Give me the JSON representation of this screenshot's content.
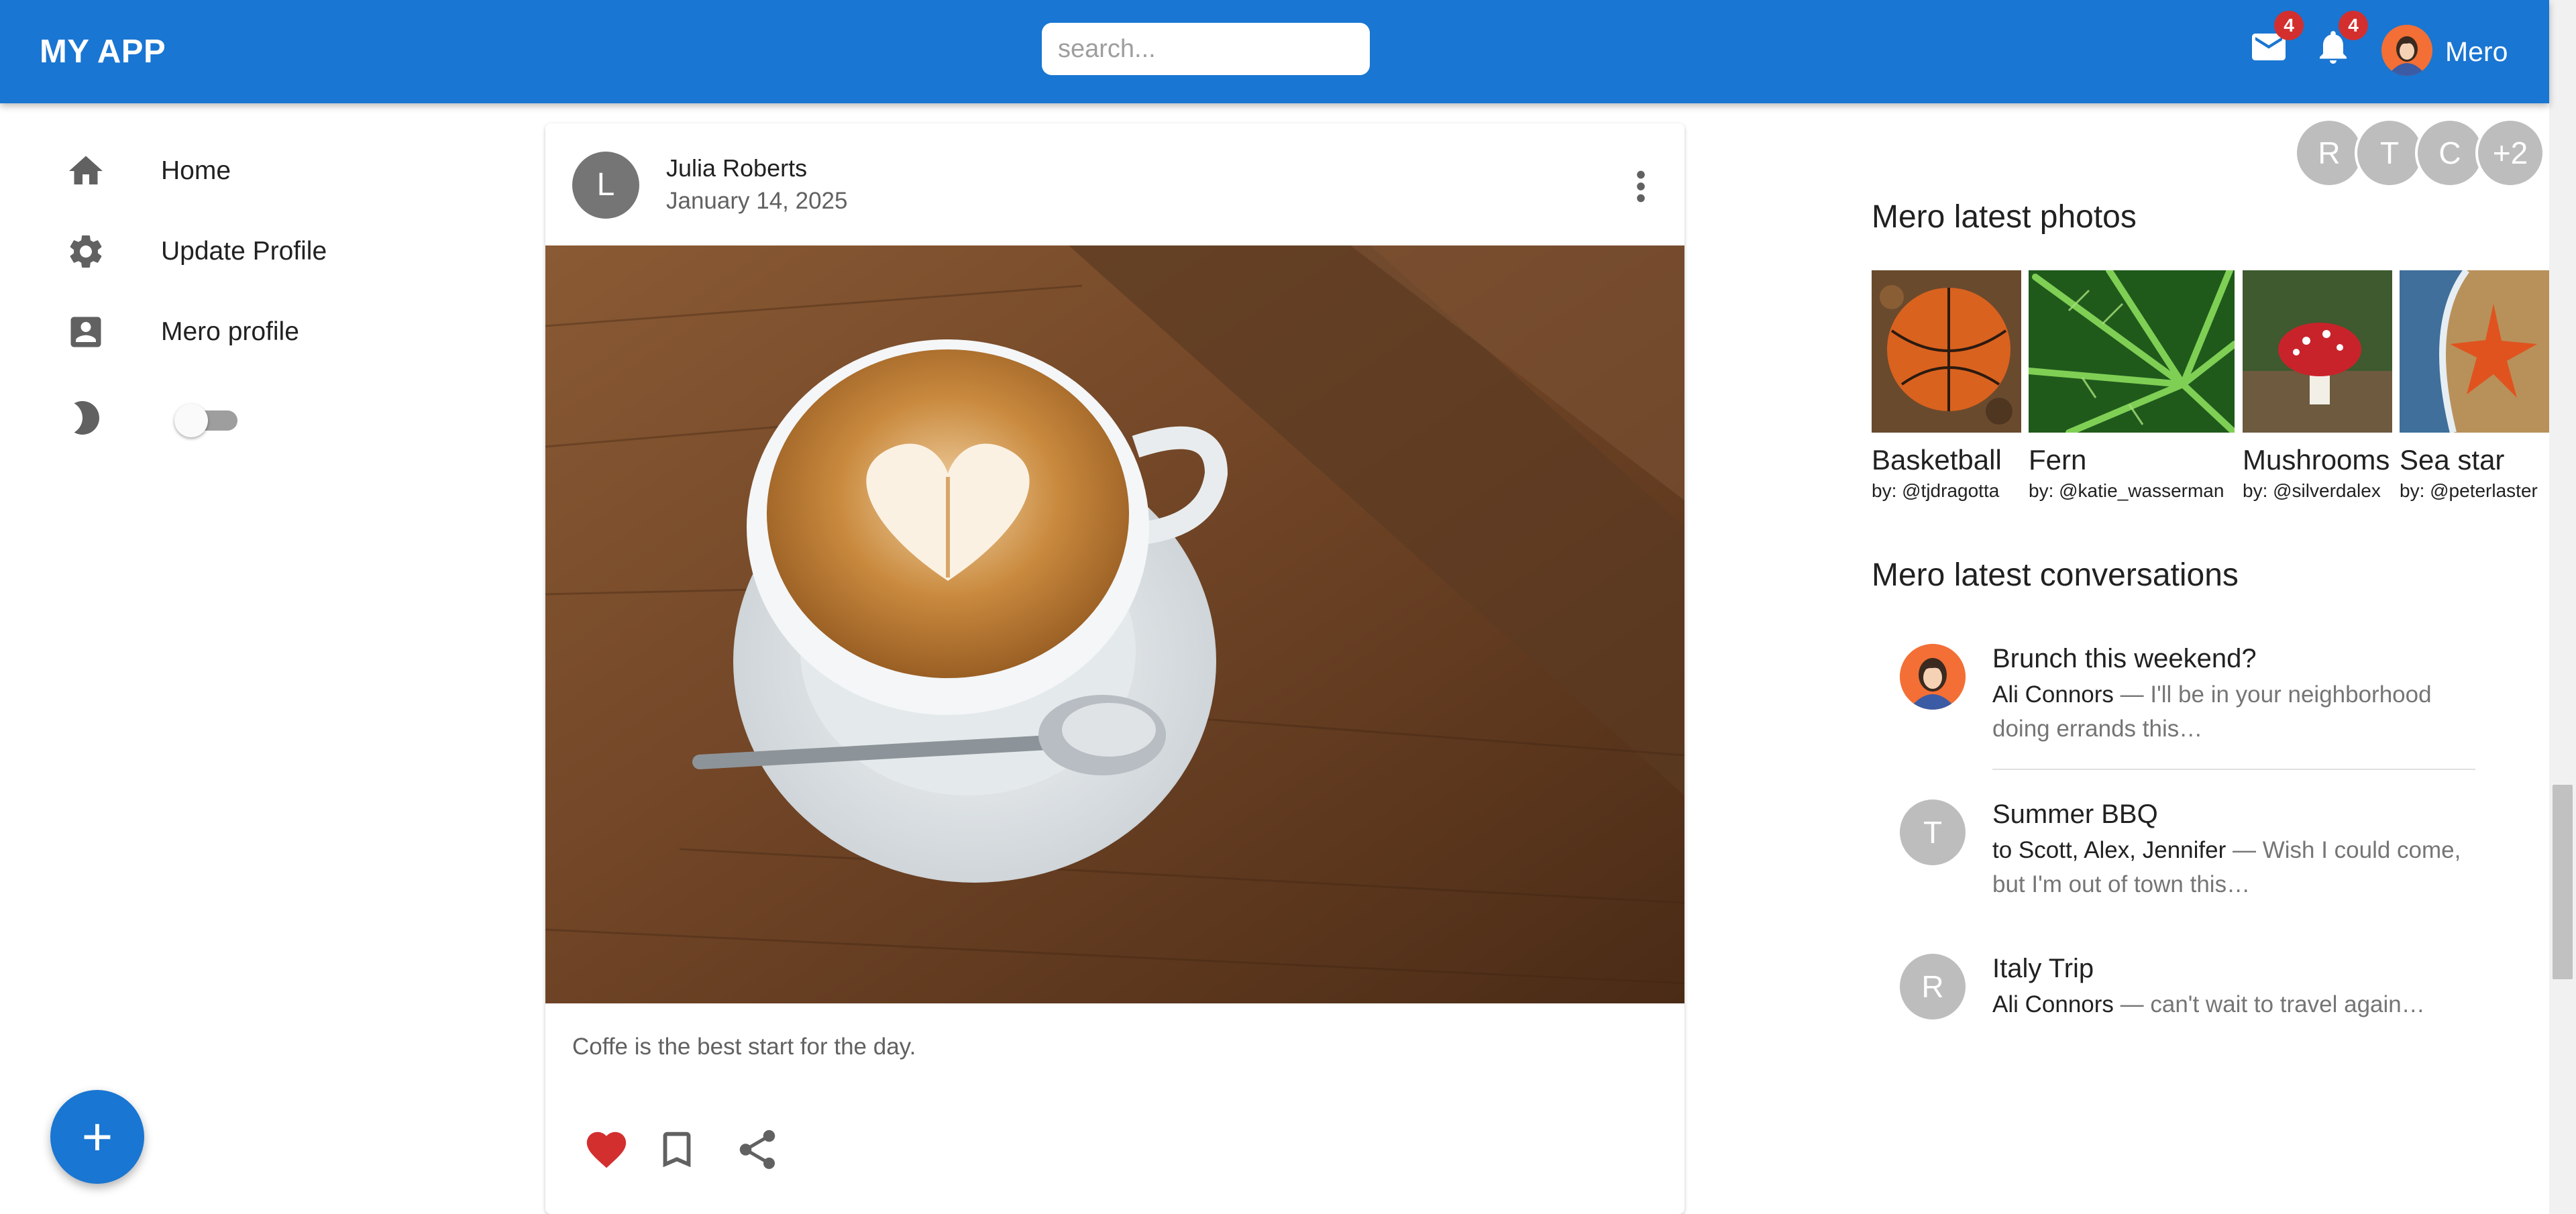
{
  "header": {
    "title": "MY APP",
    "search_placeholder": "search...",
    "mail_badge": "4",
    "notifications_badge": "4",
    "user_name": "Mero"
  },
  "sidebar": {
    "items": [
      {
        "label": "Home",
        "icon": "home-icon"
      },
      {
        "label": "Update Profile",
        "icon": "gear-icon"
      },
      {
        "label": "Mero profile",
        "icon": "account-box-icon"
      }
    ],
    "dark_mode_icon": "moon-icon",
    "dark_mode_on": false,
    "fab_label": "+"
  },
  "post": {
    "avatar_letter": "L",
    "author": "Julia Roberts",
    "date": "January 14, 2025",
    "caption": "Coffe is the best start for the day.",
    "liked": true
  },
  "right": {
    "avatar_group": [
      "R",
      "T",
      "C",
      "+2"
    ],
    "photos_title": "Mero latest photos",
    "photos": [
      {
        "title": "Basketball",
        "by": "by: @tjdragotta"
      },
      {
        "title": "Fern",
        "by": "by: @katie_wasserman"
      },
      {
        "title": "Mushrooms",
        "by": "by: @silverdalex"
      },
      {
        "title": "Sea star",
        "by": "by: @peterlaster"
      }
    ],
    "conversations_title": "Mero latest conversations",
    "conversations": [
      {
        "title": "Brunch this weekend?",
        "from": "Ali Connors",
        "text": " — I'll be in your neighborhood doing errands this…",
        "avatar": ""
      },
      {
        "title": "Summer BBQ",
        "from": "to Scott, Alex, Jennifer",
        "text": " — Wish I could come, but I'm out of town this…",
        "avatar": "T"
      },
      {
        "title": "Italy Trip",
        "from": "Ali Connors",
        "text": " — can't wait to travel again…",
        "avatar": "R"
      }
    ]
  },
  "colors": {
    "primary": "#1976d2",
    "badge": "#d32f2f",
    "heart": "#d32f2f"
  }
}
